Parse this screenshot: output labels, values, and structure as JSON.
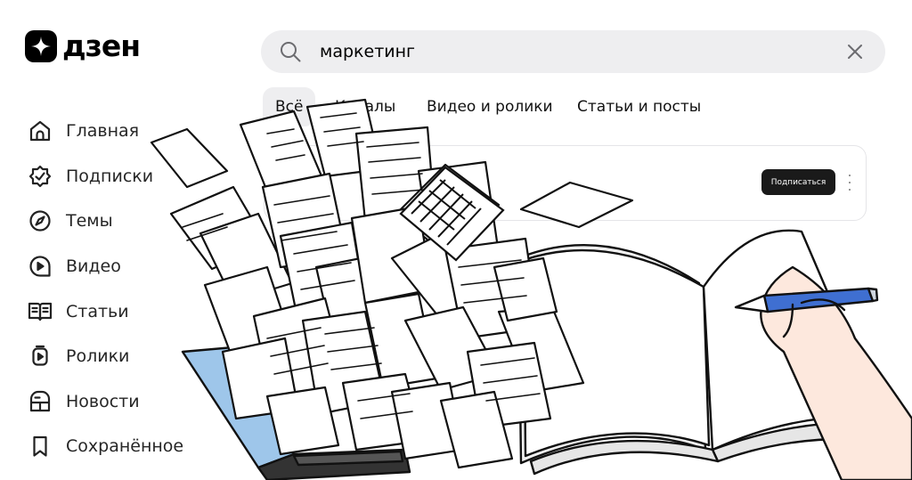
{
  "brand": {
    "name": "дзен",
    "logo_icon": "dzen-star-icon"
  },
  "search": {
    "query": "маркетинг",
    "placeholder": ""
  },
  "tabs": [
    {
      "label": "Всё",
      "active": true
    },
    {
      "label": "Каналы",
      "active": false
    },
    {
      "label": "Видео и ролики",
      "active": false
    },
    {
      "label": "Статьи и посты",
      "active": false
    }
  ],
  "sidebar": {
    "items": [
      {
        "label": "Главная",
        "icon": "home-icon"
      },
      {
        "label": "Подписки",
        "icon": "subscriptions-icon"
      },
      {
        "label": "Темы",
        "icon": "compass-icon"
      },
      {
        "label": "Видео",
        "icon": "video-icon"
      },
      {
        "label": "Статьи",
        "icon": "book-icon"
      },
      {
        "label": "Ролики",
        "icon": "shorts-icon"
      },
      {
        "label": "Новости",
        "icon": "news-icon"
      },
      {
        "label": "Сохранённое",
        "icon": "bookmark-icon"
      }
    ]
  },
  "result_card": {
    "subscribe_label": "Подписаться",
    "more_icon": "more-vertical-icon"
  },
  "colors": {
    "search_bg": "#eeeef0",
    "button_dark": "#1a1a1a",
    "pen_blue": "#3f6fd1",
    "laptop_screen": "#9ec6ea"
  }
}
